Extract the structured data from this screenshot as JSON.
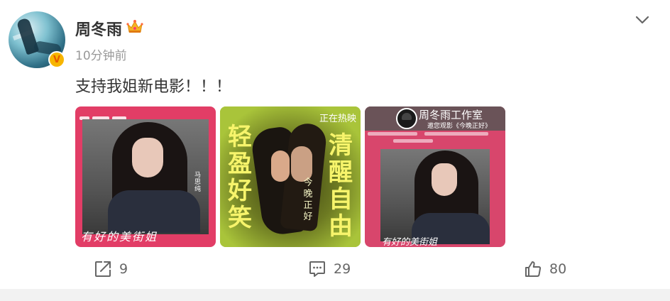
{
  "post": {
    "username": "周冬雨",
    "timestamp": "10分钟前",
    "text": "支持我姐新电影！！！",
    "verified_badge": "V",
    "images": [
      {
        "script_caption": "有好的美街姐",
        "vertical_caption": "马思纯"
      },
      {
        "top_label": "正在热映",
        "left_text": "轻盈好笑",
        "right_text": "清醒自由",
        "middle_text": "今晚正好"
      },
      {
        "studio_title": "周冬雨工作室",
        "studio_subtitle": "邀您观影《今晚正好》",
        "script_caption": "有好的美街姐"
      }
    ]
  },
  "actions": {
    "share_count": "9",
    "comment_count": "29",
    "like_count": "80"
  },
  "colors": {
    "text_primary": "#333333",
    "text_muted": "#999999",
    "action_gray": "#666666",
    "divider": "#f2f2f2"
  }
}
